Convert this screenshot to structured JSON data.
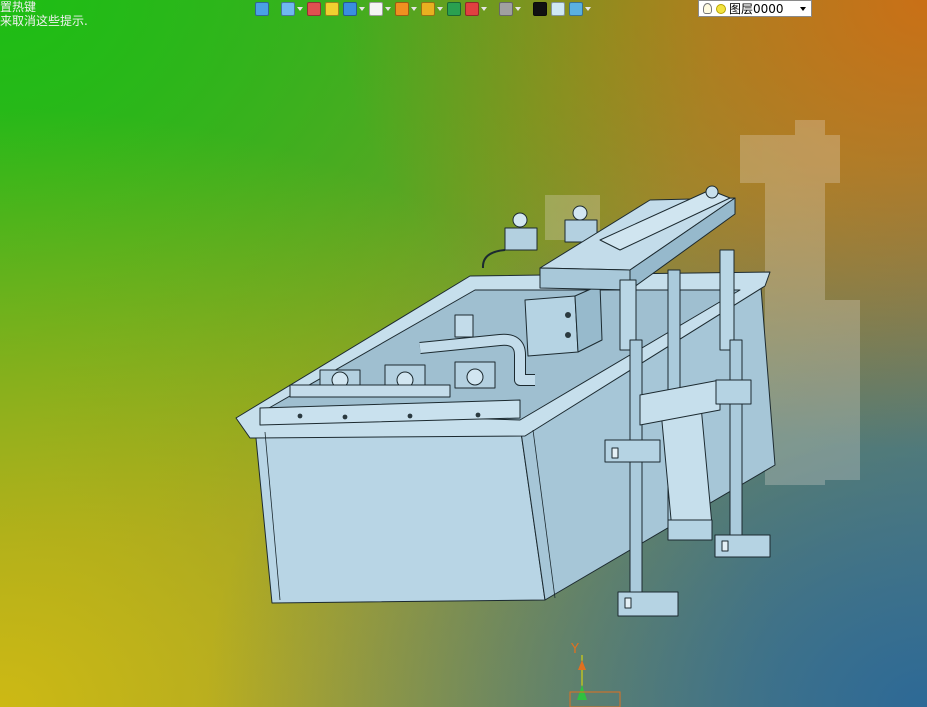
{
  "hint": {
    "line1": "置热键",
    "line2": "来取消这些提示."
  },
  "toolbar": {
    "items": [
      {
        "icon": "sketch-icon",
        "color": "#4aa0e6",
        "dropdown": false
      },
      {
        "icon": "view-orient-icon",
        "color": "#6fb8f0",
        "dropdown": true
      },
      {
        "icon": "pencil-icon",
        "color": "#e05050",
        "dropdown": false
      },
      {
        "icon": "solid-box-icon",
        "color": "#f0d030",
        "dropdown": false
      },
      {
        "icon": "cube-blue-icon",
        "color": "#3a8ee0",
        "dropdown": true
      },
      {
        "icon": "cube-white-icon",
        "color": "#f4f4f4",
        "dropdown": true
      },
      {
        "icon": "section-icon",
        "color": "#f09020",
        "dropdown": true
      },
      {
        "icon": "zoom-icon",
        "color": "#e8b020",
        "dropdown": true
      },
      {
        "icon": "fit-icon",
        "color": "#2aa050",
        "dropdown": false
      },
      {
        "icon": "rotate-icon",
        "color": "#e04040",
        "dropdown": true
      },
      {
        "icon": "display-mode-icon",
        "color": "#a0a0a0",
        "dropdown": true
      },
      {
        "icon": "line-color-icon",
        "color": "#111111",
        "dropdown": false
      },
      {
        "icon": "face-color-icon",
        "color": "#cfe8f5",
        "dropdown": false
      },
      {
        "icon": "material-icon",
        "color": "#5ab0e0",
        "dropdown": true
      }
    ]
  },
  "layer": {
    "value": "图层0000"
  },
  "triad": {
    "y_label": "Y"
  },
  "colors": {
    "model_fill": "#b5d3e3",
    "model_dark": "#8fb4c7",
    "model_edge": "#1c2a30"
  }
}
